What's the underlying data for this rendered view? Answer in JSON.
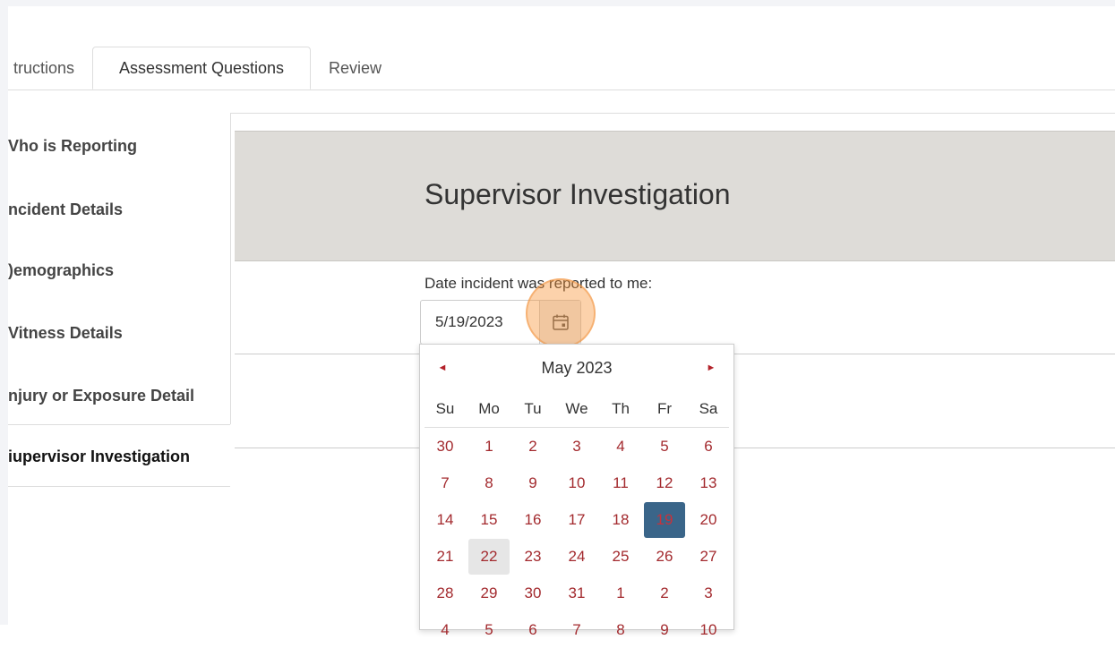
{
  "tabs": [
    {
      "label": "tructions"
    },
    {
      "label": "Assessment Questions"
    },
    {
      "label": "Review"
    }
  ],
  "sidebar": {
    "items": [
      {
        "label": "Vho is Reporting"
      },
      {
        "label": "ncident Details"
      },
      {
        "label": ")emographics"
      },
      {
        "label": "Vitness Details"
      },
      {
        "label": "njury or Exposure Detail"
      },
      {
        "label": "iupervisor Investigation"
      }
    ]
  },
  "panel": {
    "title": "Supervisor Investigation"
  },
  "date_field": {
    "label": "Date incident was reported to me:",
    "value": "5/19/2023"
  },
  "calendar": {
    "month_label": "May 2023",
    "prev_symbol": "◄",
    "next_symbol": "►",
    "weekdays": [
      "Su",
      "Mo",
      "Tu",
      "We",
      "Th",
      "Fr",
      "Sa"
    ],
    "weeks": [
      [
        "30",
        "1",
        "2",
        "3",
        "4",
        "5",
        "6"
      ],
      [
        "7",
        "8",
        "9",
        "10",
        "11",
        "12",
        "13"
      ],
      [
        "14",
        "15",
        "16",
        "17",
        "18",
        "19",
        "20"
      ],
      [
        "21",
        "22",
        "23",
        "24",
        "25",
        "26",
        "27"
      ],
      [
        "28",
        "29",
        "30",
        "31",
        "1",
        "2",
        "3"
      ],
      [
        "4",
        "5",
        "6",
        "7",
        "8",
        "9",
        "10"
      ]
    ],
    "selected_day": "19",
    "today_day": "22"
  },
  "colors": {
    "accent": "#b3222a",
    "selected_bg": "#3a6589",
    "highlight": "#f79438"
  }
}
